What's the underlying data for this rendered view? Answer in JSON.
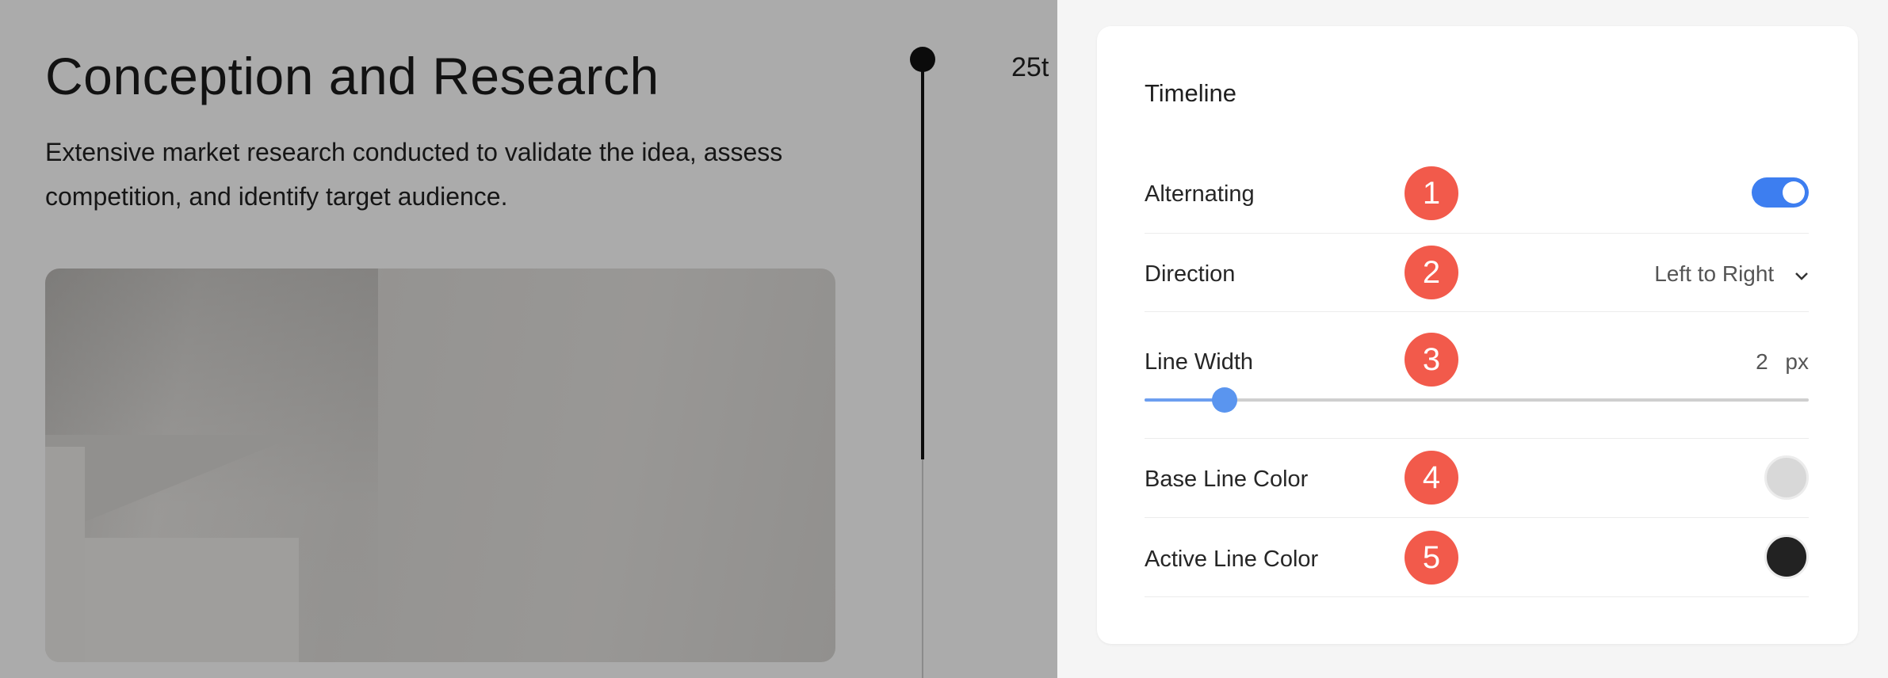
{
  "preview": {
    "title": "Conception and Research",
    "description": "Extensive market research conducted to validate the idea, assess competition, and identify target audience.",
    "date_fragment": "25t"
  },
  "panel": {
    "title": "Timeline",
    "rows": [
      {
        "label": "Alternating",
        "badge": "1",
        "toggle_on": true
      },
      {
        "label": "Direction",
        "badge": "2",
        "value": "Left to Right"
      },
      {
        "label": "Line Width",
        "badge": "3",
        "value": "2",
        "unit": "px",
        "slider_fraction": 0.12
      },
      {
        "label": "Base Line Color",
        "badge": "4",
        "color": "#d8d8d8"
      },
      {
        "label": "Active Line Color",
        "badge": "5",
        "color": "#222222"
      }
    ]
  },
  "colors": {
    "accent": "#3d7ef0",
    "badge": "#f25a4b",
    "slider": "#5a95ef"
  },
  "icons": {
    "direction_dropdown": "chevron-down-icon"
  }
}
